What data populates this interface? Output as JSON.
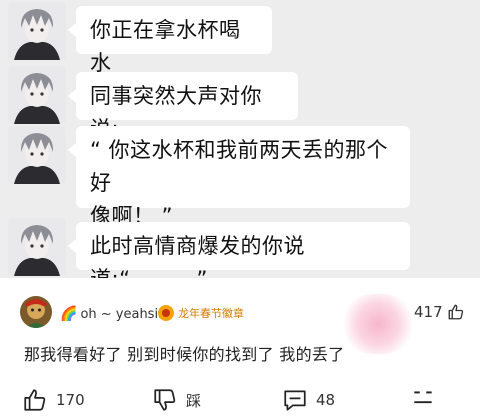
{
  "messages": [
    {
      "text": "你正在拿水杯喝水"
    },
    {
      "text": "同事突然大声对你说:"
    },
    {
      "text_line1": "“ 你这水杯和我前两天丢的那个好",
      "text_line2": "像啊！ ”"
    },
    {
      "text": "此时高情商爆发的你说道:“______”"
    }
  ],
  "comment": {
    "username": "oh ~ yeahsir",
    "username_prefix_icon": "rainbow-icon",
    "badge": "龙年春节徽章",
    "like_count": "417",
    "text": "那我得看好了 别到时候你的找到了 我的丢了",
    "accent_color": "#d67b00"
  },
  "actions": {
    "like_count": "170",
    "dislike_label": "踩",
    "comment_count": "48"
  }
}
